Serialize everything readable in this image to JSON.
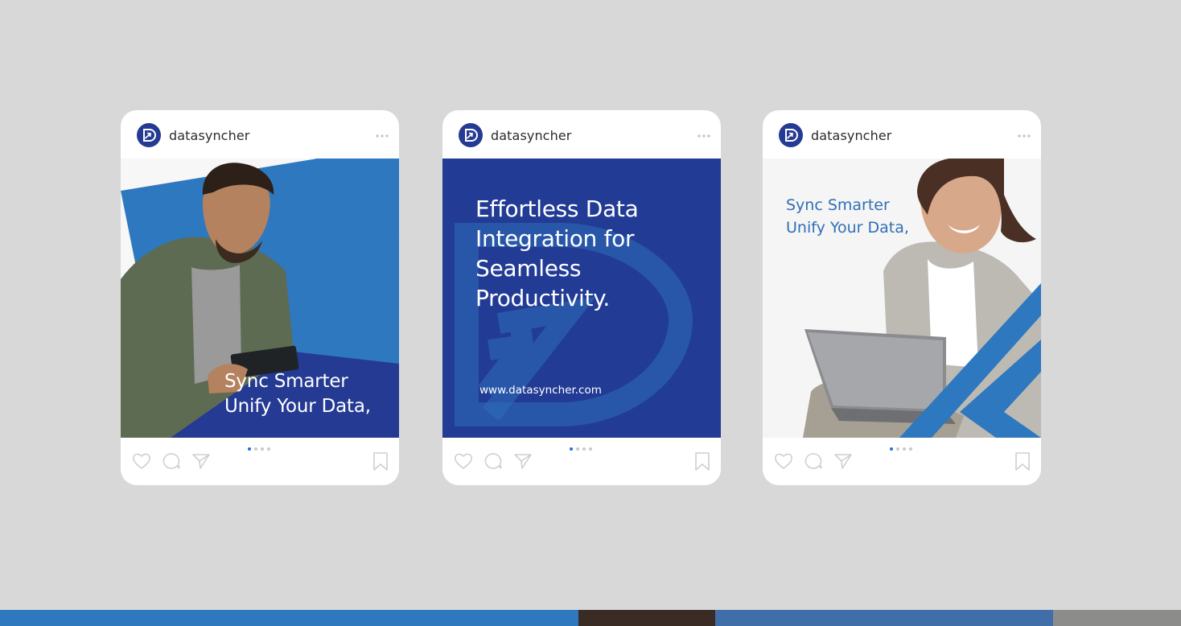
{
  "posts": [
    {
      "username": "datasyncher",
      "tagline": [
        "Sync Smarter",
        "Unify Your Data,"
      ]
    },
    {
      "username": "datasyncher",
      "headline": [
        "Effortless Data",
        "Integration for",
        "Seamless",
        "Productivity."
      ],
      "url": "www.datasyncher.com"
    },
    {
      "username": "datasyncher",
      "tagline": [
        "Sync Smarter",
        "Unify Your Data,"
      ]
    }
  ],
  "carousel": {
    "total": 4,
    "active": 1
  },
  "icons": {
    "header": [
      "brand-logo-icon",
      "more-options-icon"
    ],
    "footer": [
      "heart-icon",
      "comment-icon",
      "send-icon",
      "bookmark-icon"
    ]
  },
  "colors": {
    "background": "#d8d8d8",
    "brand_navy": "#243a93",
    "brand_blue": "#2e78c0",
    "card": "#ffffff",
    "dot_active": "#1f73d6"
  }
}
